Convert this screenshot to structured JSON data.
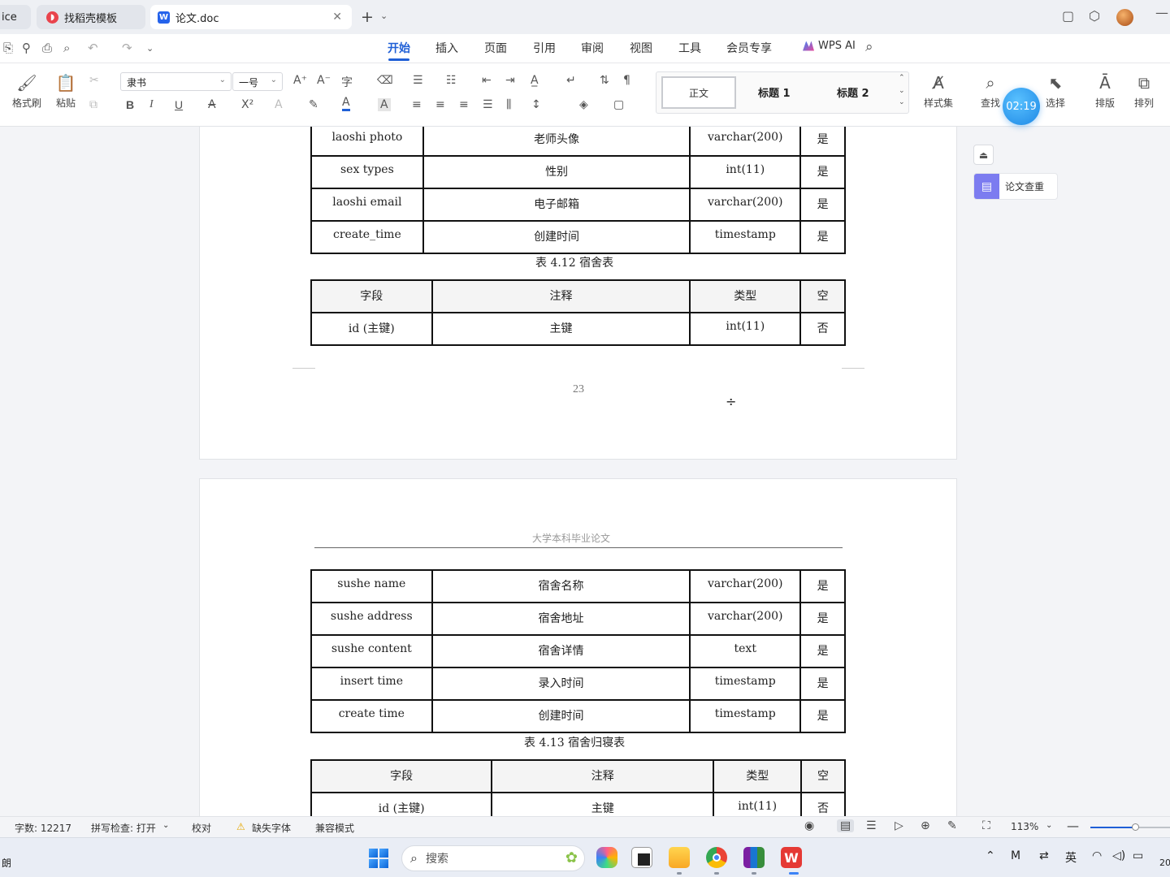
{
  "tabs": {
    "partial_label": "ice",
    "daoke_label": "找稻壳模板",
    "doc_label": "论文.doc",
    "close_glyph": "✕",
    "new_tab_glyph": "+"
  },
  "menu": {
    "items": [
      "开始",
      "插入",
      "页面",
      "引用",
      "审阅",
      "视图",
      "工具",
      "会员专享"
    ],
    "active": "开始",
    "wps_ai": "WPS AI"
  },
  "ribbon": {
    "format_painter": "格式刷",
    "paste": "粘贴",
    "font_name": "隶书",
    "font_size": "一号",
    "bold": "B",
    "italic": "I",
    "underline": "U",
    "style_normal": "正文",
    "style_h1": "标题 1",
    "style_h2": "标题 2",
    "style_set": "样式集",
    "find": "查找",
    "select": "选择",
    "layout": "排版",
    "arrange": "排列",
    "timer": "02:19"
  },
  "side": {
    "thesis_check": "论文查重"
  },
  "page1": {
    "table_top": [
      [
        "laoshi  photo",
        "老师头像",
        "varchar(200)",
        "是"
      ],
      [
        "sex  types",
        "性别",
        "int(11)",
        "是"
      ],
      [
        "laoshi  email",
        "电子邮箱",
        "varchar(200)",
        "是"
      ],
      [
        "create_time",
        "创建时间",
        "timestamp",
        "是"
      ]
    ],
    "caption": "表 4.12  宿舍表",
    "table2_header": [
      "字段",
      "注释",
      "类型",
      "空"
    ],
    "table2_rows": [
      [
        "id (主键)",
        "主键",
        "int(11)",
        "否"
      ]
    ],
    "page_number": "23"
  },
  "page2": {
    "header": "大学本科毕业论文",
    "table_rows": [
      [
        "sushe  name",
        "宿舍名称",
        "varchar(200)",
        "是"
      ],
      [
        "sushe  address",
        "宿舍地址",
        "varchar(200)",
        "是"
      ],
      [
        "sushe  content",
        "宿舍详情",
        "text",
        "是"
      ],
      [
        "insert  time",
        "录入时间",
        "timestamp",
        "是"
      ],
      [
        "create  time",
        "创建时间",
        "timestamp",
        "是"
      ]
    ],
    "caption": "表 4.13 宿舍归寝表",
    "table2_header": [
      "字段",
      "注释",
      "类型",
      "空"
    ],
    "table2_rows": [
      [
        "id (主键)",
        "主键",
        "int(11)",
        "否"
      ]
    ]
  },
  "status": {
    "word_count": "字数: 12217",
    "spell_check": "拼写检查: 打开",
    "proofread": "校对",
    "missing_font": "缺失字体",
    "compat_mode": "兼容模式",
    "zoom": "113%",
    "zoom_fraction": 0.56
  },
  "taskbar": {
    "search_placeholder": "搜索",
    "left_text": "朗",
    "ime": "英",
    "clock_partial": "20"
  }
}
